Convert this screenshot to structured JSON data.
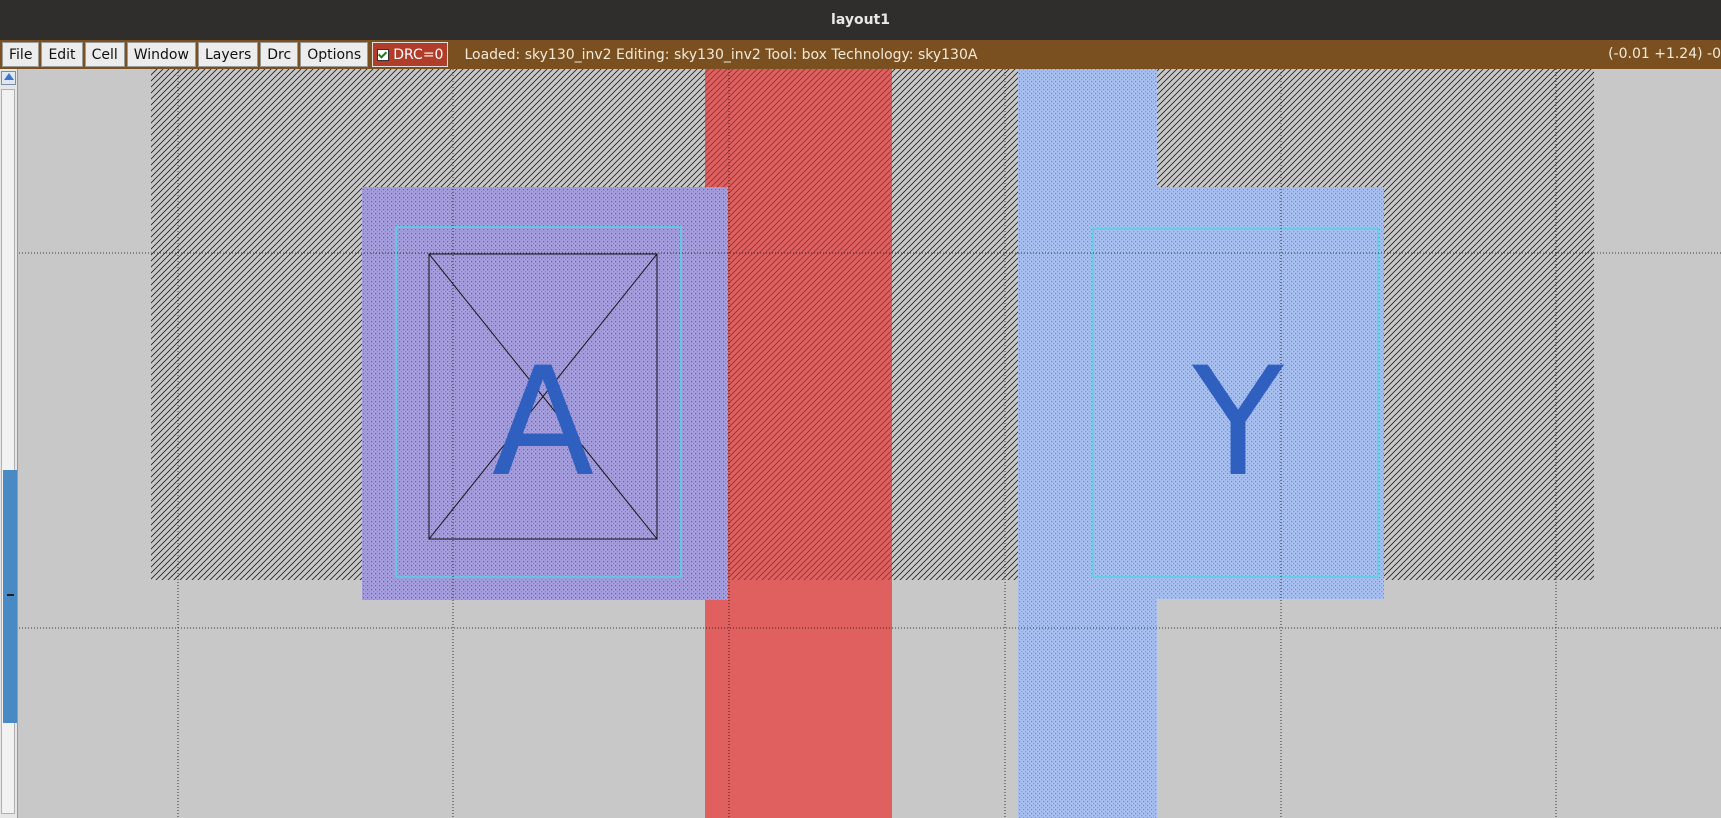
{
  "window": {
    "title": "layout1"
  },
  "menu": [
    "File",
    "Edit",
    "Cell",
    "Window",
    "Layers",
    "Drc",
    "Options"
  ],
  "drc": {
    "label": "DRC=0",
    "checked": true
  },
  "status": {
    "text": "Loaded: sky130_inv2 Editing: sky130_inv2 Tool: box  Technology: sky130A",
    "coords": "(-0.01 +1.24) -0"
  },
  "layout": {
    "labels": {
      "input": "A",
      "output": "Y"
    },
    "colors": {
      "background": "#c8c8c8",
      "poly": "#e06060",
      "local_interconnect": "#a4a0de",
      "metal1": "#a8c0f0",
      "label_text": "#2f5fbf",
      "menubar": "#7a5020"
    }
  }
}
